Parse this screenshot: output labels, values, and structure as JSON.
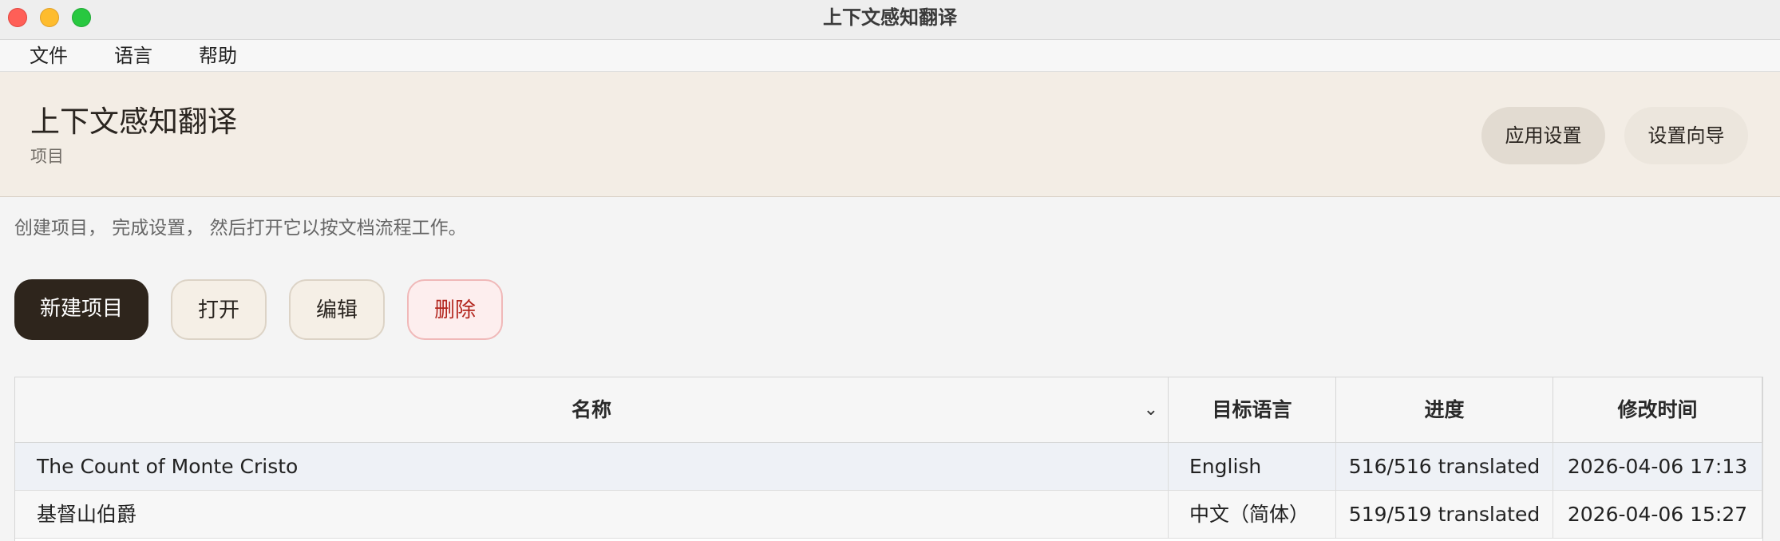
{
  "window": {
    "title": "上下文感知翻译"
  },
  "menubar": {
    "items": [
      {
        "label": "文件"
      },
      {
        "label": "语言"
      },
      {
        "label": "帮助"
      }
    ]
  },
  "header": {
    "title": "上下文感知翻译",
    "subtitle": "项目",
    "app_settings_label": "应用设置",
    "setup_wizard_label": "设置向导"
  },
  "hint": "创建项目， 完成设置， 然后打开它以按文档流程工作。",
  "actions": {
    "new_label": "新建项目",
    "open_label": "打开",
    "edit_label": "编辑",
    "delete_label": "删除"
  },
  "table": {
    "columns": [
      "名称",
      "目标语言",
      "进度",
      "修改时间"
    ],
    "sort_icon": "chevron-down-icon",
    "rows": [
      {
        "name": "The Count of Monte Cristo",
        "language": "English",
        "progress": "516/516 translated",
        "modified": "2026-04-06 17:13"
      },
      {
        "name": "基督山伯爵",
        "language": "中文（简体）",
        "progress": "519/519 translated",
        "modified": "2026-04-06 15:27"
      }
    ]
  },
  "colors": {
    "primary_button": "#2e251c",
    "header_bg": "#f3ede5",
    "danger": "#b3261e"
  }
}
